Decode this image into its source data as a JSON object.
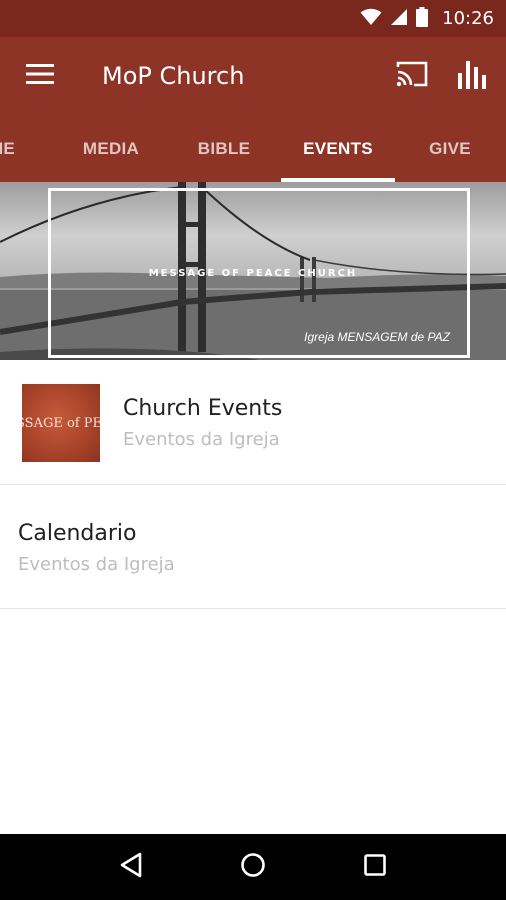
{
  "status_bar": {
    "time": "10:26"
  },
  "app_bar": {
    "title": "MoP Church"
  },
  "tabs": [
    {
      "label": "ME",
      "active": false
    },
    {
      "label": "MEDIA",
      "active": false
    },
    {
      "label": "BIBLE",
      "active": false
    },
    {
      "label": "EVENTS",
      "active": true
    },
    {
      "label": "GIVE",
      "active": false
    }
  ],
  "banner": {
    "title": "MESSAGE OF PEACE CHURCH",
    "subtitle": "Igreja MENSAGEM de PAZ"
  },
  "list": [
    {
      "title": "Church Events",
      "subtitle": "Eventos da Igreja",
      "thumb_text": "SSAGE of PE"
    },
    {
      "title": "Calendario",
      "subtitle": "Eventos da Igreja"
    }
  ],
  "colors": {
    "app_bar": "#8e3426",
    "status_bar": "#7a271d",
    "thumbnail": "#a9442a"
  }
}
